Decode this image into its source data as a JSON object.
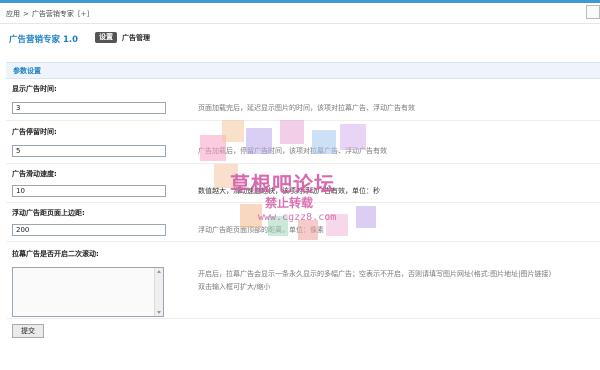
{
  "breadcrumb": {
    "root": "应用",
    "sep": ">",
    "current": "广告营销专家",
    "plus": "[+]"
  },
  "app": {
    "title": "广告营销专家 1.0"
  },
  "tabs": [
    {
      "label": "设置",
      "active": true
    },
    {
      "label": "广告管理",
      "active": false
    }
  ],
  "section": {
    "title": "参数设置"
  },
  "fields": [
    {
      "label": "显示广告时间:",
      "value": "3",
      "hint": "页面加载完后，延迟显示图片的时间，该项对拉幕广告、浮动广告有效"
    },
    {
      "label": "广告停留时间:",
      "value": "5",
      "hint": "广告加载后，停留广告时间，该项对拉幕广告、浮动广告有效"
    },
    {
      "label": "广告滑动速度:",
      "value": "10",
      "hint": "数值越大，滑动速度越快，该项对浮动广告有效，单位：秒"
    },
    {
      "label": "浮动广告距页面上边距:",
      "value": "200",
      "hint": "浮动广告距页面顶部的距离，单位：像素"
    },
    {
      "label": "拉幕广告是否开启二次滚动:",
      "value": "",
      "hint": "开启后，拉幕广告会显示一条永久显示的多幅广告；空表示不开启，否则请填写图片网址(格式:图片地址|图片链接)",
      "hint2": "双击输入框可扩大/缩小"
    }
  ],
  "submit": {
    "label": "提交"
  },
  "watermark": {
    "title": "草根吧论坛",
    "subtitle": "禁止转载",
    "url": "www.cgzz8.com"
  },
  "colors": {
    "accent": "#1f7fc4",
    "watermark": "#d35aa6"
  }
}
